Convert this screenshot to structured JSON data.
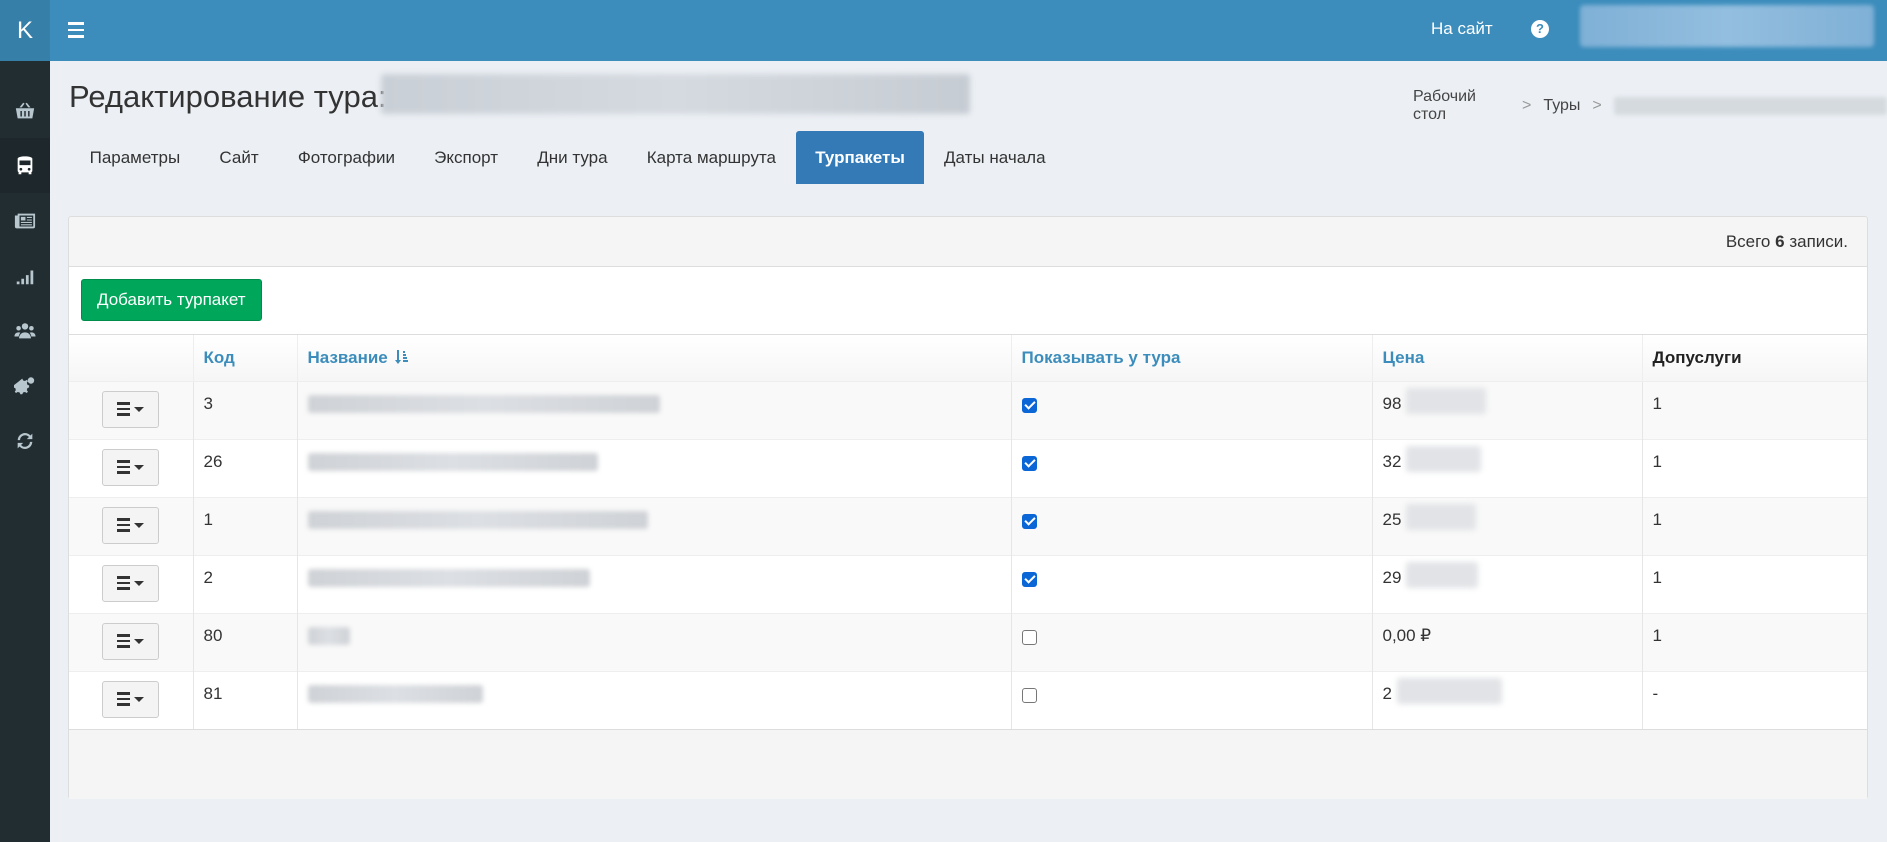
{
  "brand": {
    "logo": "K"
  },
  "sidebar": {
    "items": [
      {
        "icon": "basket-icon",
        "active": false
      },
      {
        "icon": "bus-icon",
        "active": true
      },
      {
        "icon": "newspaper-icon",
        "active": false
      },
      {
        "icon": "signal-icon",
        "active": false
      },
      {
        "icon": "users-icon",
        "active": false
      },
      {
        "icon": "gears-icon",
        "active": false
      },
      {
        "icon": "refresh-icon",
        "active": false
      }
    ]
  },
  "header": {
    "to_site": "На сайт",
    "help": "?"
  },
  "page": {
    "title": "Редактирование тура:"
  },
  "breadcrumb": {
    "item1": "Рабочий стол",
    "item2": "Туры",
    "sep": ">"
  },
  "tabs": [
    {
      "label": "Параметры",
      "active": false
    },
    {
      "label": "Сайт",
      "active": false
    },
    {
      "label": "Фотографии",
      "active": false
    },
    {
      "label": "Экспорт",
      "active": false
    },
    {
      "label": "Дни тура",
      "active": false
    },
    {
      "label": "Карта маршрута",
      "active": false
    },
    {
      "label": "Турпакеты",
      "active": true
    },
    {
      "label": "Даты начала",
      "active": false
    }
  ],
  "summary": {
    "prefix": "Всего",
    "count": "6",
    "suffix": "записи."
  },
  "toolbar": {
    "add_label": "Добавить турпакет"
  },
  "table": {
    "columns": {
      "code": "Код",
      "name": "Название",
      "show": "Показывать у тура",
      "price": "Цена",
      "extras": "Допуслуги"
    },
    "rows": [
      {
        "code": "3",
        "show": true,
        "price": "98",
        "extras": "1"
      },
      {
        "code": "26",
        "show": true,
        "price": "32",
        "extras": "1"
      },
      {
        "code": "1",
        "show": true,
        "price": "25",
        "extras": "1"
      },
      {
        "code": "2",
        "show": true,
        "price": "29",
        "extras": "1"
      },
      {
        "code": "80",
        "show": false,
        "price": "0,00 ₽",
        "extras": "1"
      },
      {
        "code": "81",
        "show": false,
        "price": "2",
        "extras": "-"
      }
    ]
  },
  "colors": {
    "header": "#3c8dbc",
    "sidebar": "#222d32",
    "active_tab": "#337ab7",
    "add_button": "#00a65a"
  }
}
